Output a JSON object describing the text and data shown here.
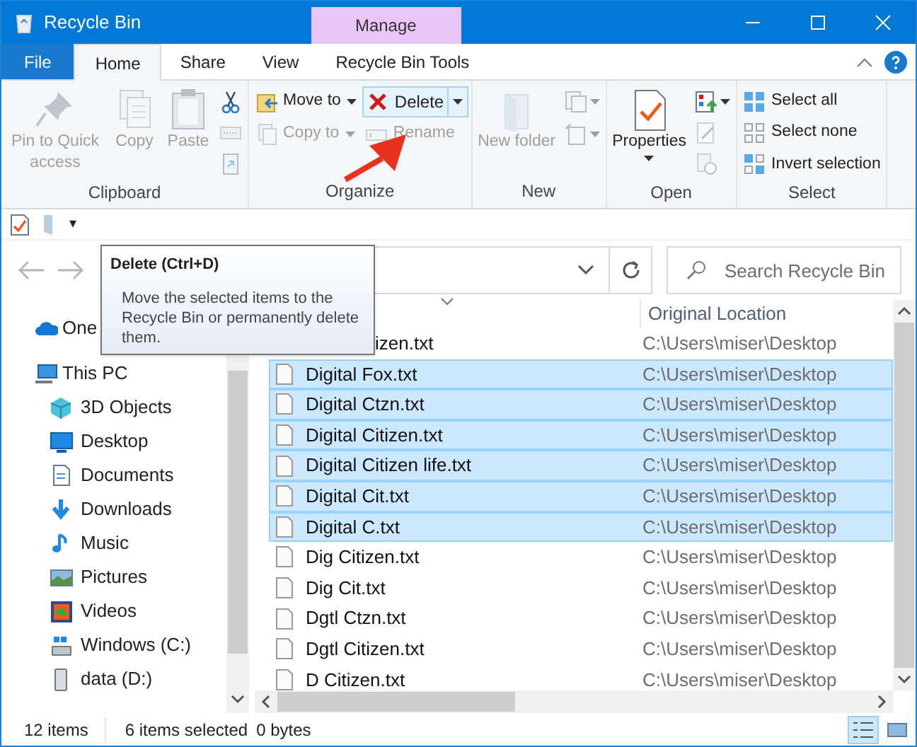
{
  "window": {
    "title": "Recycle Bin",
    "contextual_tab": "Manage"
  },
  "tabs": [
    {
      "label": "File",
      "kind": "file",
      "selected": false
    },
    {
      "label": "Home",
      "kind": "tab",
      "selected": true
    },
    {
      "label": "Share",
      "kind": "tab",
      "selected": false
    },
    {
      "label": "View",
      "kind": "tab",
      "selected": false
    },
    {
      "label": "Recycle Bin Tools",
      "kind": "tab",
      "selected": false
    }
  ],
  "ribbon": {
    "groups": [
      {
        "label": "Clipboard",
        "columns": [
          [
            {
              "kind": "large",
              "label": "Pin to Quick access",
              "disabled": true
            }
          ],
          [
            {
              "kind": "large",
              "label": "Copy",
              "disabled": true
            }
          ],
          [
            {
              "kind": "large",
              "label": "Paste",
              "disabled": true
            }
          ],
          [
            {
              "kind": "icon",
              "disabled": false
            },
            {
              "kind": "icon",
              "disabled": true
            },
            {
              "kind": "icon",
              "disabled": true
            }
          ]
        ]
      },
      {
        "label": "Organize",
        "columns": [
          [
            {
              "kind": "small",
              "label": "Move to",
              "disabled": false,
              "dropdown": true
            },
            {
              "kind": "small",
              "label": "Copy to",
              "disabled": true,
              "dropdown": true
            }
          ],
          [
            {
              "kind": "split",
              "label": "Delete",
              "disabled": false,
              "dropdown": true,
              "hovered": true
            },
            {
              "kind": "small",
              "label": "Rename",
              "disabled": true
            }
          ]
        ]
      },
      {
        "label": "New",
        "columns": [
          [
            {
              "kind": "large",
              "label": "New folder",
              "disabled": true
            }
          ],
          [
            {
              "kind": "icon",
              "disabled": true,
              "dropdown": true
            },
            {
              "kind": "icon",
              "disabled": true,
              "dropdown": true
            }
          ]
        ]
      },
      {
        "label": "Open",
        "columns": [
          [
            {
              "kind": "large",
              "label": "Properties",
              "disabled": false,
              "dropdown": true
            }
          ],
          [
            {
              "kind": "icon",
              "disabled": false,
              "dropdown": true
            },
            {
              "kind": "icon",
              "disabled": true
            },
            {
              "kind": "icon",
              "disabled": true
            }
          ]
        ]
      },
      {
        "label": "Select",
        "columns": [
          [
            {
              "kind": "small",
              "label": "Select all",
              "disabled": false
            },
            {
              "kind": "small",
              "label": "Select none",
              "disabled": false
            },
            {
              "kind": "small",
              "label": "Invert selection",
              "disabled": false
            }
          ]
        ]
      }
    ]
  },
  "quick_access": {
    "caret": "▾"
  },
  "search": {
    "placeholder": "Search Recycle Bin"
  },
  "tooltip": {
    "title": "Delete (Ctrl+D)",
    "text": "Move the selected items to the Recycle Bin or permanently delete them."
  },
  "sidebar": {
    "items": [
      {
        "label": "One"
      },
      {
        "label": "This PC",
        "children": [
          {
            "label": "3D Objects"
          },
          {
            "label": "Desktop"
          },
          {
            "label": "Documents"
          },
          {
            "label": "Downloads"
          },
          {
            "label": "Music"
          },
          {
            "label": "Pictures"
          },
          {
            "label": "Videos"
          },
          {
            "label": "Windows (C:)"
          },
          {
            "label": "data (D:)"
          }
        ]
      }
    ]
  },
  "table": {
    "columns": [
      "Original Location"
    ],
    "rows": [
      {
        "name": "izen.txt",
        "location": "C:\\Users\\miser\\Desktop",
        "selected": false
      },
      {
        "name": "Digital Fox.txt",
        "location": "C:\\Users\\miser\\Desktop",
        "selected": true
      },
      {
        "name": "Digital Ctzn.txt",
        "location": "C:\\Users\\miser\\Desktop",
        "selected": true
      },
      {
        "name": "Digital Citizen.txt",
        "location": "C:\\Users\\miser\\Desktop",
        "selected": true
      },
      {
        "name": "Digital Citizen life.txt",
        "location": "C:\\Users\\miser\\Desktop",
        "selected": true
      },
      {
        "name": "Digital Cit.txt",
        "location": "C:\\Users\\miser\\Desktop",
        "selected": true
      },
      {
        "name": "Digital C.txt",
        "location": "C:\\Users\\miser\\Desktop",
        "selected": true
      },
      {
        "name": "Dig Citizen.txt",
        "location": "C:\\Users\\miser\\Desktop",
        "selected": false
      },
      {
        "name": "Dig Cit.txt",
        "location": "C:\\Users\\miser\\Desktop",
        "selected": false
      },
      {
        "name": "Dgtl Ctzn.txt",
        "location": "C:\\Users\\miser\\Desktop",
        "selected": false
      },
      {
        "name": "Dgtl Citizen.txt",
        "location": "C:\\Users\\miser\\Desktop",
        "selected": false
      },
      {
        "name": "D Citizen.txt",
        "location": "C:\\Users\\miser\\Desktop",
        "selected": false
      }
    ]
  },
  "status_bar": {
    "items": [
      "12 items",
      "6 items selected",
      "0 bytes"
    ],
    "views": [
      {
        "kind": "details",
        "selected": true
      },
      {
        "kind": "large_icons",
        "selected": false
      }
    ]
  }
}
